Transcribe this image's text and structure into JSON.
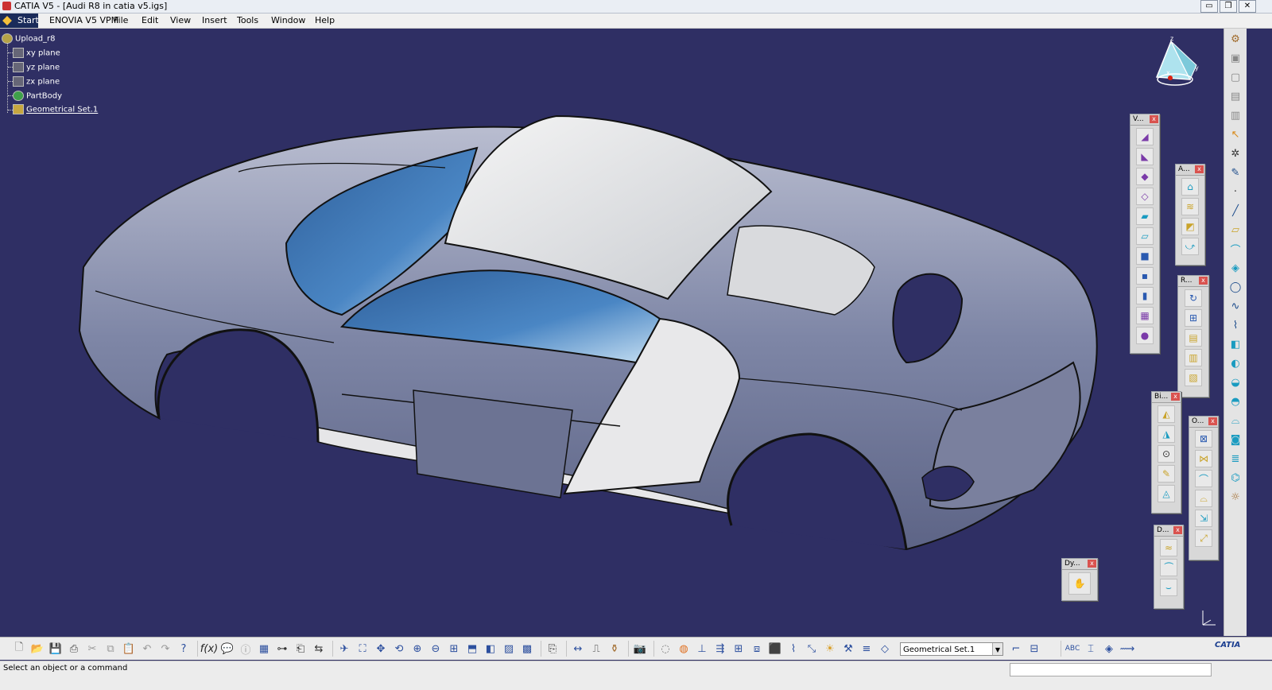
{
  "window": {
    "title": "CATIA V5 - [Audi R8 in catia v5.igs]",
    "controls": [
      "▭",
      "❐",
      "✕"
    ]
  },
  "menu": {
    "start": "Start",
    "items": [
      "ENOVIA V5 VPM",
      "File",
      "Edit",
      "View",
      "Insert",
      "Tools",
      "Window",
      "Help"
    ]
  },
  "tree": {
    "root": "Upload_r8",
    "items": [
      "xy plane",
      "yz plane",
      "zx plane",
      "PartBody",
      "Geometrical Set.1"
    ]
  },
  "compass": {
    "labels": [
      "z",
      "x",
      "y"
    ]
  },
  "floating_toolbars": [
    {
      "title": "V...",
      "close": "x"
    },
    {
      "title": "A...",
      "close": "x"
    },
    {
      "title": "R...",
      "close": "x"
    },
    {
      "title": "Bi...",
      "close": "x"
    },
    {
      "title": "O...",
      "close": "x"
    },
    {
      "title": "D...",
      "close": "x"
    },
    {
      "title": "Dy...",
      "close": "x"
    }
  ],
  "bottom_toolbar": {
    "combo_value": "Geometrical Set.1",
    "combo_arrow": "▼"
  },
  "status": {
    "message": "Select an object or a command"
  },
  "logo": {
    "text": "CATIA"
  },
  "colors": {
    "viewport": "#2f2f64",
    "car_body": "#8f96b4",
    "glass": "#3d6ea8",
    "roof": "#eceef0"
  }
}
